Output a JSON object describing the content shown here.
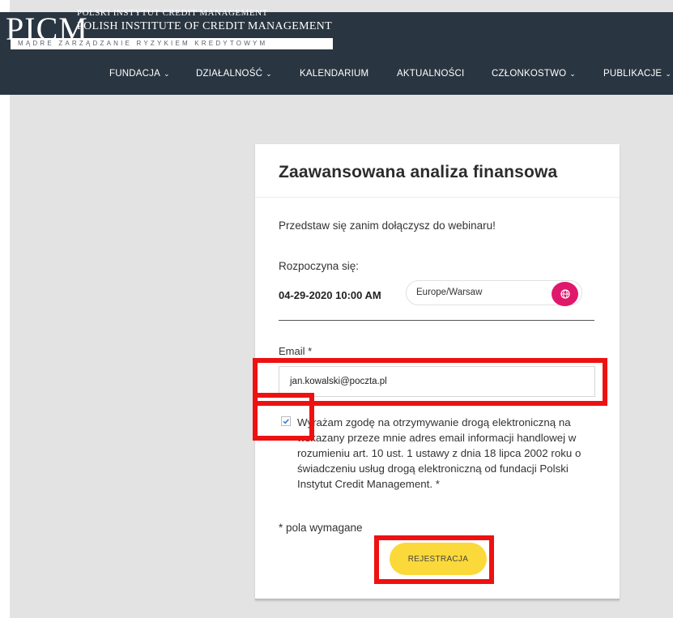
{
  "header": {
    "logo_letters": "PICM",
    "logo_line1": "POLSKI INSTYTUT CREDIT MANAGEMENT",
    "logo_line2": "POLISH INSTITUTE OF CREDIT MANAGEMENT",
    "tagline": "MĄDRE ZARZĄDZANIE RYZYKIEM KREDYTOWYM",
    "background_color": "#293541"
  },
  "nav": {
    "items": [
      {
        "label": "FUNDACJA",
        "has_dropdown": true
      },
      {
        "label": "DZIAŁALNOŚĆ",
        "has_dropdown": true
      },
      {
        "label": "KALENDARIUM",
        "has_dropdown": false
      },
      {
        "label": "AKTUALNOŚCI",
        "has_dropdown": false
      },
      {
        "label": "CZŁONKOSTWO",
        "has_dropdown": true
      },
      {
        "label": "PUBLIKACJE",
        "has_dropdown": true
      }
    ]
  },
  "form": {
    "title": "Zaawansowana analiza finansowa",
    "intro": "Przedstaw się zanim dołączysz do webinaru!",
    "starts_label": "Rozpoczyna się:",
    "start_datetime": "04-29-2020 10:00 AM",
    "timezone": "Europe/Warsaw",
    "timezone_icon": "globe-icon",
    "email_label": "Email *",
    "email_value": "jan.kowalski@poczta.pl",
    "consent_checked": true,
    "consent_text": "Wyrażam zgodę na otrzymywanie drogą elektroniczną na wskazany przeze mnie adres email informacji handlowej w rozumieniu art. 10 ust. 1 ustawy z dnia 18 lipca 2002 roku o świadczeniu usług drogą elektroniczną od fundacji Polski Instytut Credit Management. *",
    "required_note": "* pola wymagane",
    "register_label": "REJESTRACJA"
  },
  "colors": {
    "accent_pink": "#e0186c",
    "button_yellow": "#fbd93b",
    "highlight_red": "#ee1111"
  }
}
